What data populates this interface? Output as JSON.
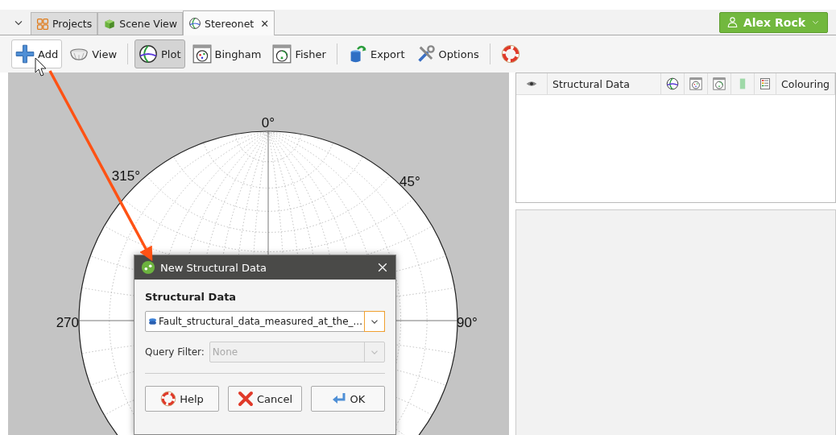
{
  "tab_bar": {
    "tabs": [
      {
        "label": "Projects",
        "kind": "projects",
        "selected": false,
        "closable": false
      },
      {
        "label": "Scene View",
        "kind": "scene",
        "selected": false,
        "closable": false
      },
      {
        "label": "Stereonet",
        "kind": "stereonet",
        "selected": true,
        "closable": true
      }
    ],
    "close_glyph": "✕",
    "user": {
      "label": "Alex Rock"
    }
  },
  "toolbar": [
    {
      "kind": "add",
      "label": "Add",
      "pressed": false,
      "hovered": true
    },
    {
      "kind": "view",
      "label": "View",
      "pressed": false,
      "hovered": false
    },
    {
      "kind": "separator"
    },
    {
      "kind": "plot",
      "label": "Plot",
      "pressed": true,
      "hovered": false
    },
    {
      "kind": "bingham",
      "label": "Bingham",
      "pressed": false,
      "hovered": false
    },
    {
      "kind": "fisher",
      "label": "Fisher",
      "pressed": false,
      "hovered": false
    },
    {
      "kind": "separator"
    },
    {
      "kind": "export",
      "label": "Export",
      "pressed": false,
      "hovered": false
    },
    {
      "kind": "options",
      "label": "Options",
      "pressed": false,
      "hovered": false
    },
    {
      "kind": "separator"
    },
    {
      "kind": "help",
      "pressed": false,
      "hovered": false
    }
  ],
  "stereonet": {
    "labels": [
      {
        "text": "0°"
      },
      {
        "text": "315°"
      },
      {
        "text": "45°"
      },
      {
        "text": "270"
      },
      {
        "text": "90°"
      }
    ]
  },
  "table": {
    "columns": [
      {
        "kind": "eye"
      },
      {
        "kind": "text",
        "label": "Structural Data"
      },
      {
        "kind": "plot"
      },
      {
        "kind": "bingham"
      },
      {
        "kind": "fisher"
      },
      {
        "kind": "swatch"
      },
      {
        "kind": "legend"
      },
      {
        "kind": "text",
        "label": "Colouring"
      }
    ]
  },
  "dialog": {
    "title": "New Structural Data",
    "section": "Structural Data",
    "dataset": {
      "value": "Fault_structural_data_measured_at_the_...",
      "focused": true,
      "disabled": false
    },
    "query_filter": {
      "label": "Query Filter:",
      "value": "None",
      "disabled": true
    },
    "buttons": [
      {
        "kind": "help",
        "label": "Help"
      },
      {
        "kind": "cancel",
        "label": "Cancel"
      },
      {
        "kind": "ok",
        "label": "OK"
      }
    ]
  }
}
